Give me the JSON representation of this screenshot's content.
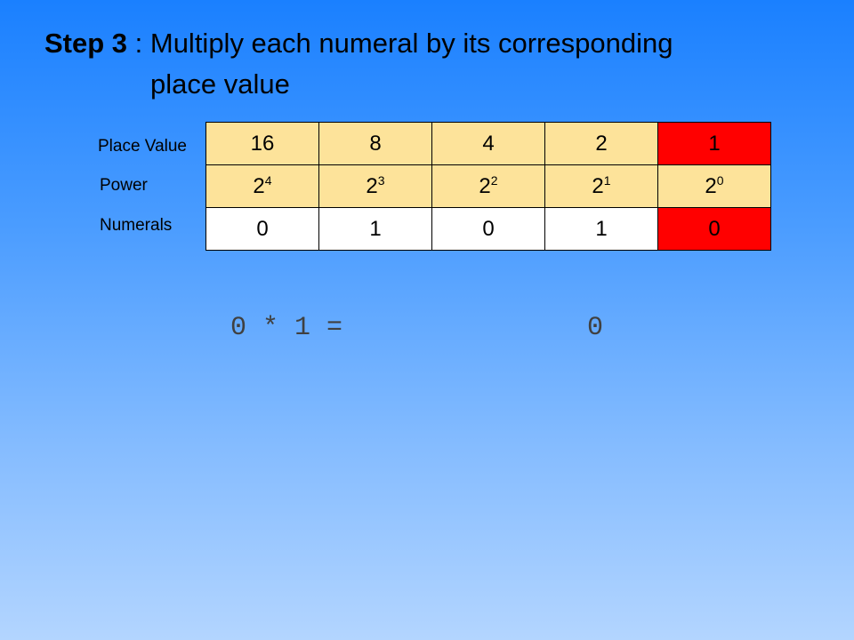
{
  "title": {
    "step": "Step 3",
    "line1": " : Multiply each numeral by its corresponding",
    "line2": "place value"
  },
  "row_labels": {
    "place_value": "Place Value",
    "power": "Power",
    "numerals": "Numerals"
  },
  "place_values": [
    "16",
    "8",
    "4",
    "2",
    "1"
  ],
  "powers": [
    {
      "base": "2",
      "exp": "4"
    },
    {
      "base": "2",
      "exp": "3"
    },
    {
      "base": "2",
      "exp": "2"
    },
    {
      "base": "2",
      "exp": "1"
    },
    {
      "base": "2",
      "exp": "0"
    }
  ],
  "numerals": [
    "0",
    "1",
    "0",
    "1",
    "0"
  ],
  "highlight_color": "#ff0000",
  "header_color": "#fde39a",
  "calculation": {
    "expression": "0 * 1 =",
    "result": "0"
  }
}
